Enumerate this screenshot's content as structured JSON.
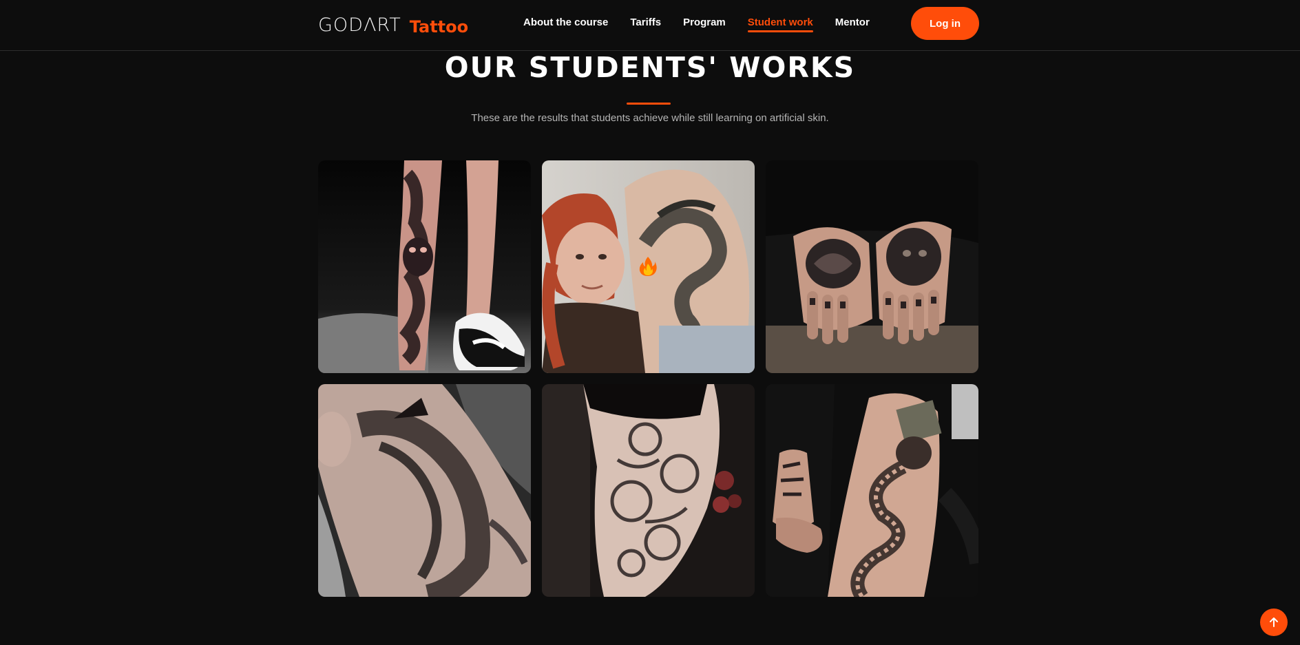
{
  "header": {
    "logo_main": "GODΛRT",
    "logo_accent": "Tattoo",
    "nav": [
      {
        "label": "About the course",
        "active": false
      },
      {
        "label": "Tariffs",
        "active": false
      },
      {
        "label": "Program",
        "active": false
      },
      {
        "label": "Student work",
        "active": true
      },
      {
        "label": "Mentor",
        "active": false
      }
    ],
    "login_label": "Log in"
  },
  "section": {
    "title": "OUR STUDENTS' WORKS",
    "subtitle": "These are the results that students achieve while still learning on artificial skin."
  },
  "gallery": {
    "items": [
      {
        "icon": "tiger-leg-tattoo-photo"
      },
      {
        "icon": "dragon-back-tattoo-photo"
      },
      {
        "icon": "hands-tattoo-photo"
      },
      {
        "icon": "neck-tattoo-photo"
      },
      {
        "icon": "floral-thigh-tattoo-photo"
      },
      {
        "icon": "snake-forearm-tattoo-photo"
      }
    ]
  },
  "colors": {
    "accent": "#ff4d0a",
    "background": "#0d0d0d",
    "text": "#ffffff",
    "muted": "#b5b5b5"
  },
  "icons": {
    "fire": "fire-icon",
    "scroll_top": "arrow-up-icon"
  }
}
